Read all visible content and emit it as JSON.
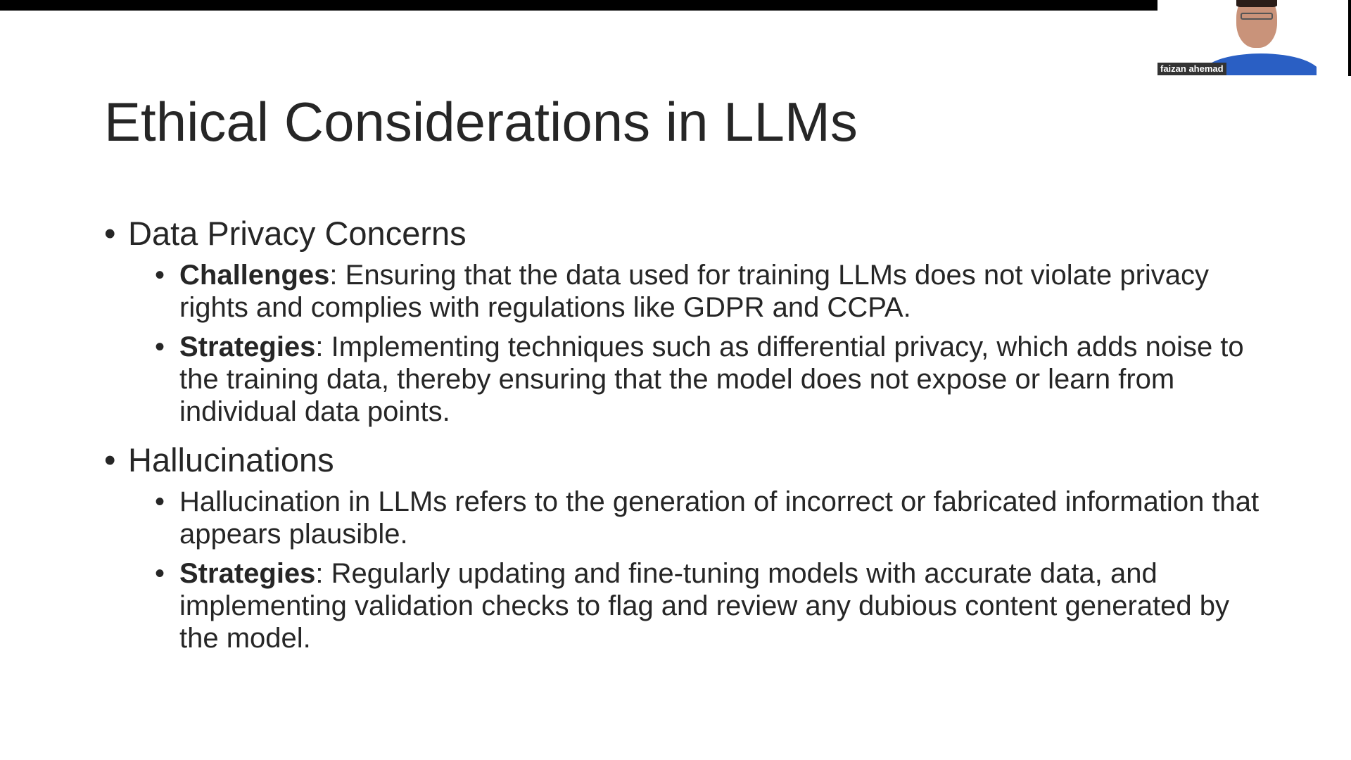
{
  "meeting": {
    "participant_name": "faizan ahemad"
  },
  "slide": {
    "title": "Ethical Considerations in LLMs",
    "sections": [
      {
        "heading": "Data Privacy Concerns",
        "items": [
          {
            "label": "Challenges",
            "text": ": Ensuring that the data used for training LLMs does not violate privacy rights and complies with regulations like GDPR and CCPA."
          },
          {
            "label": "Strategies",
            "text": ": Implementing techniques such as differential privacy, which adds noise to the training data, thereby ensuring that the model does not expose or learn from individual data points."
          }
        ]
      },
      {
        "heading": "Hallucinations",
        "items": [
          {
            "label": "",
            "text": "Hallucination in LLMs refers to the generation of incorrect or fabricated information that appears plausible."
          },
          {
            "label": "Strategies",
            "text": ": Regularly updating and fine-tuning models with accurate data, and implementing validation checks to flag and review any dubious content generated by the model."
          }
        ]
      }
    ]
  }
}
